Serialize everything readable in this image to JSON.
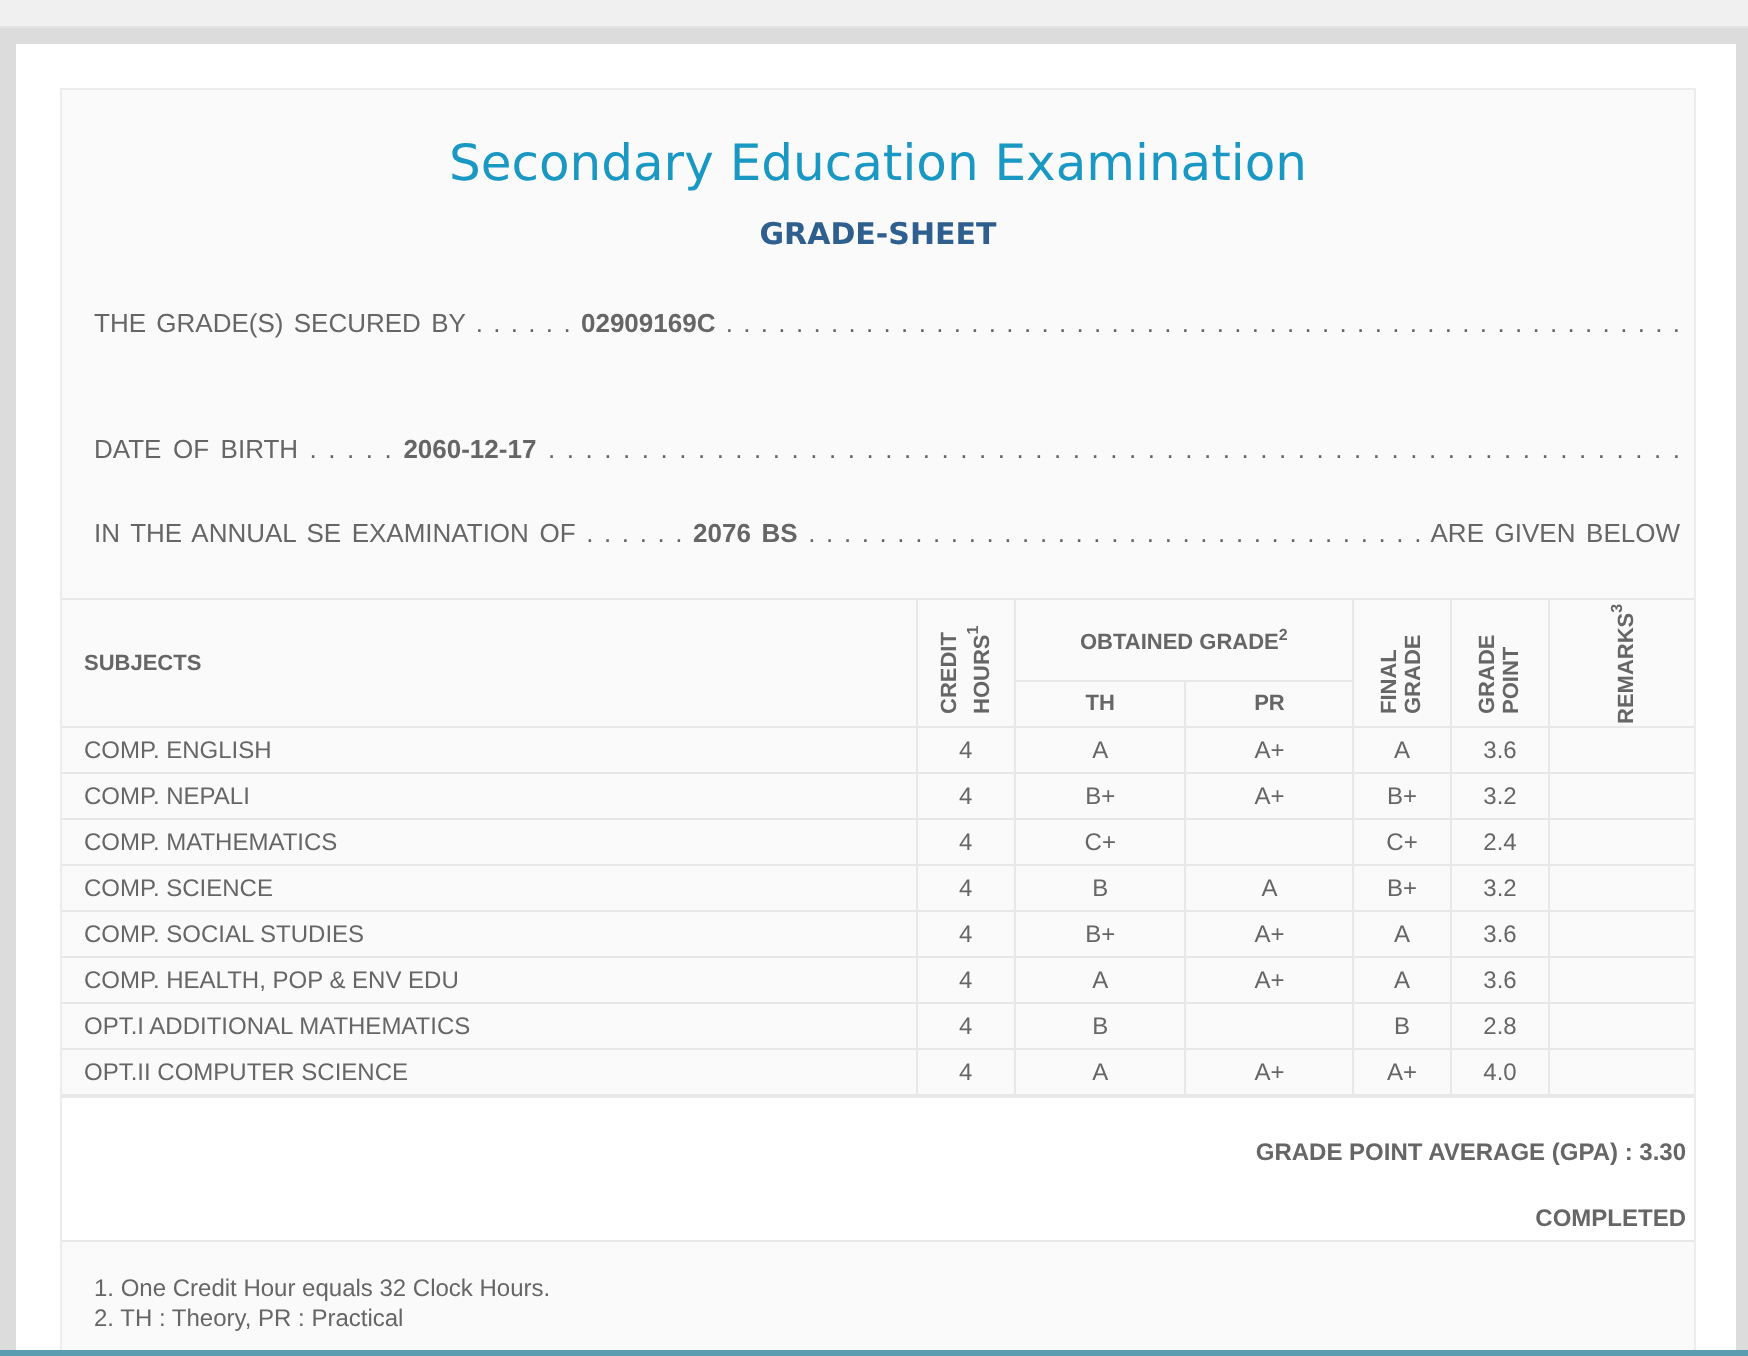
{
  "title": "Secondary Education Examination",
  "subtitle": "GRADE-SHEET",
  "info_lines": [
    "THE GRADE(S) SECURED BY . . . . . . **02909169C** . . . . . . . . . . . . . . . . . . . . . . . . . . . . . . . . . . . . . . . . . . . . . . . . . . . . . . .",
    "DATE OF BIRTH . . . . . **2060-12-17** . . . . . . . . . . . . . . . . . . . . . . . . . . . . . . . . . . . . . . . . . . . . . . . . . . . . . . . . . . . . .",
    "IN THE ANNUAL SE EXAMINATION OF . . . . . . **2076 BS** . . . . . . . . . . . . . . . . . . . . . . . . . . . . . . . . . . . ARE GIVEN BELOW"
  ],
  "table": {
    "columns": {
      "subjects": "SUBJECTS",
      "credit": "CREDIT HOURS$^{1}$",
      "obtained": "OBTAINED GRADE$^{2}$",
      "th": "TH",
      "pr": "PR",
      "final": "FINAL GRADE",
      "point": "GRADE POINT",
      "remarks": "REMARKS$^{3}$"
    },
    "rows": [
      {
        "subject": "COMP. ENGLISH",
        "credit": "4",
        "th": "A",
        "pr": "A+",
        "final": "A",
        "point": "3.6"
      },
      {
        "subject": "COMP. NEPALI",
        "credit": "4",
        "th": "B+",
        "pr": "A+",
        "final": "B+",
        "point": "3.2"
      },
      {
        "subject": "COMP. MATHEMATICS",
        "credit": "4",
        "th": "C+",
        "final": "C+",
        "point": "2.4"
      },
      {
        "subject": "COMP. SCIENCE",
        "credit": "4",
        "th": "B",
        "pr": "A",
        "final": "B+",
        "point": "3.2"
      },
      {
        "subject": "COMP. SOCIAL STUDIES",
        "credit": "4",
        "th": "B+",
        "pr": "A+",
        "final": "A",
        "point": "3.6"
      },
      {
        "subject": "COMP. HEALTH, POP & ENV EDU",
        "credit": "4",
        "th": "A",
        "pr": "A+",
        "final": "A",
        "point": "3.6"
      },
      {
        "subject": "OPT.I ADDITIONAL MATHEMATICS",
        "credit": "4",
        "th": "B",
        "final": "B",
        "point": "2.8"
      },
      {
        "subject": "OPT.II COMPUTER SCIENCE",
        "credit": "4",
        "th": "A",
        "pr": "A+",
        "final": "A+",
        "point": "4.0"
      }
    ]
  },
  "gpa": "GRADE POINT AVERAGE (GPA) : 3.30",
  "result": "COMPLETED",
  "footnotes": [
    "1. One Credit Hour equals 32 Clock Hours.",
    "2. TH : Theory, PR : Practical"
  ]
}
